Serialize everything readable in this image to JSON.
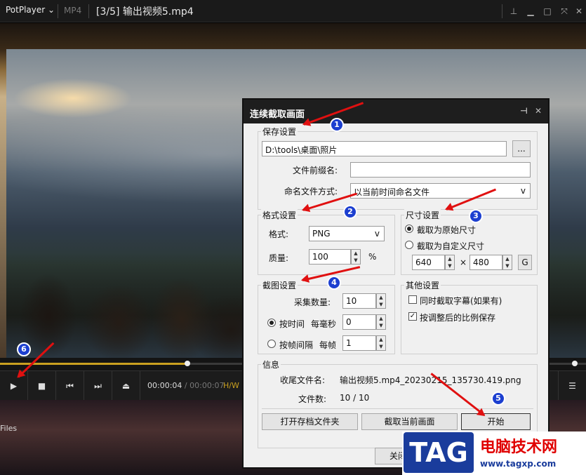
{
  "app": {
    "name": "PotPlayer",
    "format": "MP4",
    "title": "[3/5] 输出视频5.mp4",
    "window_buttons": [
      "pin-icon",
      "minimize-icon",
      "maximize-icon",
      "fullscreen-icon",
      "close-icon"
    ]
  },
  "player": {
    "time_current": "00:00:04",
    "time_sep": "/",
    "time_total": "00:00:07",
    "hw": "H/W",
    "seek_progress": 0.32,
    "files_label": "Files"
  },
  "dialog": {
    "title": "连续截取画面",
    "save": {
      "legend": "保存设置",
      "path": "D:\\tools\\桌面\\照片",
      "browse": "...",
      "prefix_label": "文件前缀名:",
      "prefix_value": "",
      "naming_label": "命名文件方式:",
      "naming_value": "以当前时间命名文件",
      "dropdown_glyph": "v"
    },
    "format": {
      "legend": "格式设置",
      "format_label": "格式:",
      "format_value": "PNG",
      "quality_label": "质量:",
      "quality_value": "100",
      "quality_unit": "%"
    },
    "size": {
      "legend": "尺寸设置",
      "original": "截取为原始尺寸",
      "custom": "截取为自定义尺寸",
      "width": "640",
      "times": "×",
      "height": "480",
      "g_btn": "G"
    },
    "capture": {
      "legend": "截图设置",
      "count_label": "采集数量:",
      "count_value": "10",
      "by_time": "按时间",
      "per_ms": "每毫秒",
      "ms_value": "0",
      "by_frame": "按帧间隔",
      "per_frame": "每帧",
      "frame_value": "1"
    },
    "other": {
      "legend": "其他设置",
      "subtitle": "同时截取字幕(如果有)",
      "ratio": "按调整后的比例保存"
    },
    "info": {
      "legend": "信息",
      "last_label": "收尾文件名:",
      "last_value": "输出视频5.mp4_20230215_135730.419.png",
      "count_label": "文件数:",
      "count_value": "10 / 10"
    },
    "buttons": {
      "open_folder": "打开存档文件夹",
      "capture_current": "截取当前画面",
      "start": "开始",
      "close": "关闭"
    }
  },
  "annotations": [
    "1",
    "2",
    "3",
    "4",
    "5",
    "6"
  ],
  "annotation_color": "#e01010",
  "badge_color": "#1c3fd0",
  "watermark": {
    "tag": "TAG",
    "name": "电脑技术网",
    "url": "www.tagxp.com"
  }
}
